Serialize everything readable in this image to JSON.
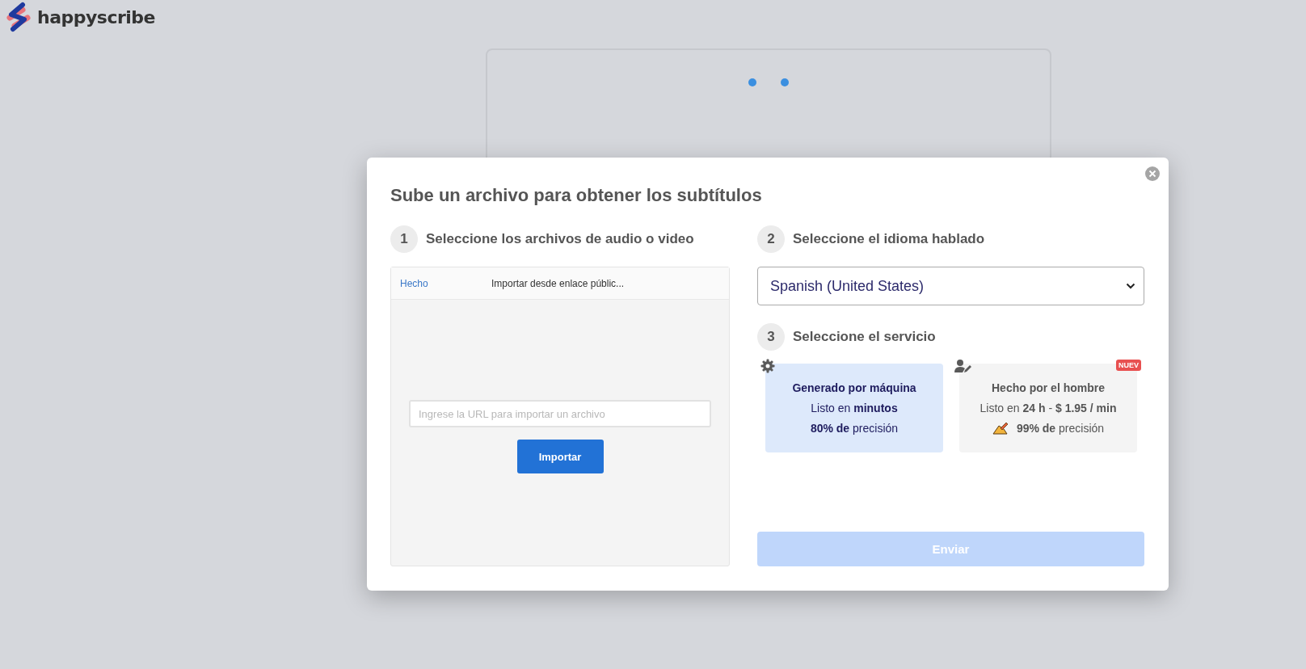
{
  "logo": {
    "text": "happyscribe"
  },
  "modal": {
    "title": "Sube un archivo para obtener los subtítulos",
    "step1": {
      "number": "1",
      "label": "Seleccione los archivos de audio o video"
    },
    "import_panel": {
      "done_link": "Hecho",
      "header": "Importar desde enlace públic...",
      "url_field": {
        "placeholder": "Ingrese la URL para importar un archivo"
      },
      "import_button": "Importar"
    },
    "step2": {
      "number": "2",
      "label": "Seleccione el idioma hablado"
    },
    "language_select": {
      "value": "Spanish (United States)"
    },
    "step3": {
      "number": "3",
      "label": "Seleccione el servicio"
    },
    "services": [
      {
        "kind": "machine",
        "title": "Generado por máquina",
        "speed": "Listo en **minutos**",
        "accuracy": "**80% de**  precisión",
        "selected": true
      },
      {
        "kind": "human",
        "title": "Hecho por el hombre",
        "speed": "Listo en **24 h**  -  **$ 1.95 / min**",
        "accuracy": "**99% de**  precisión",
        "badge": "NUEV",
        "selected": false
      }
    ],
    "submit_button": {
      "label": "Enviar",
      "disabled": true
    }
  }
}
